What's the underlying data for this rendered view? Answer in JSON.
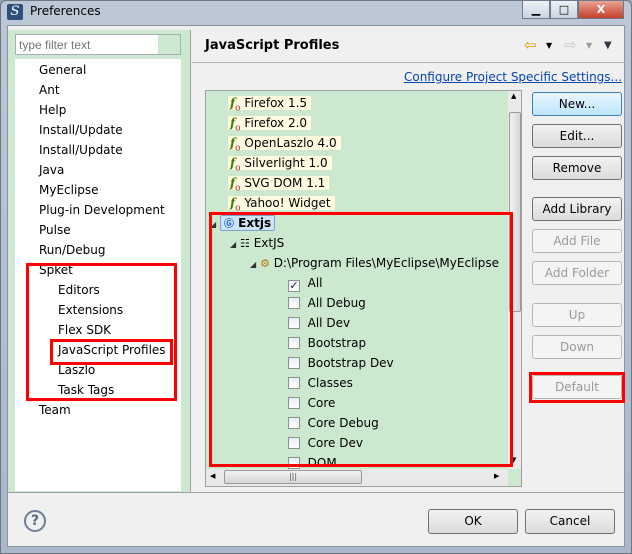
{
  "window": {
    "title": "Preferences",
    "minimize": "▁",
    "maximize": "□",
    "close": "X"
  },
  "filter": {
    "placeholder": "type filter text"
  },
  "nav": [
    {
      "label": "General",
      "level": 0
    },
    {
      "label": "Ant",
      "level": 0
    },
    {
      "label": "Help",
      "level": 0
    },
    {
      "label": "Install/Update",
      "level": 0
    },
    {
      "label": "Install/Update",
      "level": 0
    },
    {
      "label": "Java",
      "level": 0
    },
    {
      "label": "MyEclipse",
      "level": 0
    },
    {
      "label": "Plug-in Development",
      "level": 0
    },
    {
      "label": "Pulse",
      "level": 0
    },
    {
      "label": "Run/Debug",
      "level": 0
    },
    {
      "label": "Spket",
      "level": 0
    },
    {
      "label": "Editors",
      "level": 1
    },
    {
      "label": "Extensions",
      "level": 1
    },
    {
      "label": "Flex SDK",
      "level": 1
    },
    {
      "label": "JavaScript Profiles",
      "level": 1
    },
    {
      "label": "Laszlo",
      "level": 1
    },
    {
      "label": "Task Tags",
      "level": 1
    },
    {
      "label": "Team",
      "level": 0
    }
  ],
  "page": {
    "title": "JavaScript Profiles",
    "link": "Configure Project Specific Settings...",
    "back": "⇦",
    "forward": "⇨",
    "menu": "▼"
  },
  "tree": {
    "profiles": [
      "Firefox 1.5",
      "Firefox 2.0",
      "OpenLaszlo 4.0",
      "Silverlight 1.0",
      "SVG DOM 1.1",
      "Yahoo! Widget"
    ],
    "selected": "Extjs",
    "library": "ExtJS",
    "path": "D:\\Program Files\\MyEclipse\\MyEclipse",
    "files": [
      {
        "label": "All",
        "checked": true
      },
      {
        "label": "All Debug",
        "checked": false
      },
      {
        "label": "All Dev",
        "checked": false
      },
      {
        "label": "Bootstrap",
        "checked": false
      },
      {
        "label": "Bootstrap Dev",
        "checked": false
      },
      {
        "label": "Classes",
        "checked": false
      },
      {
        "label": "Core",
        "checked": false
      },
      {
        "label": "Core Debug",
        "checked": false
      },
      {
        "label": "Core Dev",
        "checked": false
      },
      {
        "label": "DOM",
        "checked": false
      }
    ]
  },
  "buttons": {
    "new": "New...",
    "edit": "Edit...",
    "remove": "Remove",
    "add_library": "Add Library",
    "add_file": "Add File",
    "add_folder": "Add Folder",
    "up": "Up",
    "down": "Down",
    "default": "Default"
  },
  "footer": {
    "help": "?",
    "ok": "OK",
    "cancel": "Cancel"
  },
  "colors": {
    "panel_bg": "#cce8cf",
    "highlight": "#ff0000",
    "link": "#0645ad"
  }
}
